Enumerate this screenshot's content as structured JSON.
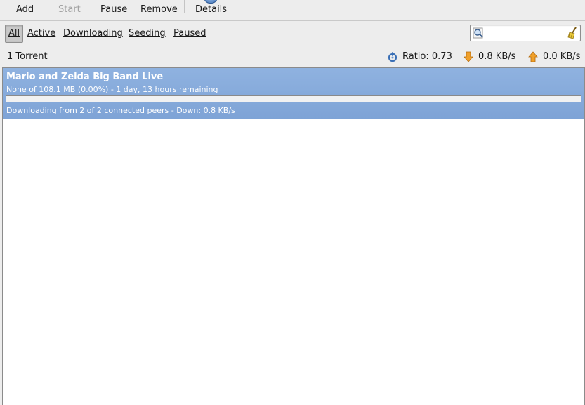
{
  "toolbar": {
    "add_label": "Add",
    "start_label": "Start",
    "pause_label": "Pause",
    "remove_label": "Remove",
    "details_label": "Details"
  },
  "filters": {
    "all": "All",
    "active": "Active",
    "downloading": "Downloading",
    "seeding": "Seeding",
    "paused": "Paused",
    "selected": "All"
  },
  "search": {
    "value": "",
    "placeholder": ""
  },
  "status": {
    "torrent_count": "1 Torrent",
    "ratio": "Ratio: 0.73",
    "down_speed": "0.8 KB/s",
    "up_speed": "0.0 KB/s"
  },
  "torrents": [
    {
      "name": "Mario and Zelda Big Band Live",
      "progress_text": "None of 108.1 MB (0.00%) - 1 day, 13 hours remaining",
      "progress": 0.0,
      "status_text": "Downloading from 2 of 2 connected peers - Down: 0.8 KB/s"
    }
  ],
  "colors": {
    "selection": "#8fb2e0",
    "down_arrow": "#e8901c",
    "up_arrow": "#e8901c",
    "ratio_icon": "#3a6fb5"
  }
}
